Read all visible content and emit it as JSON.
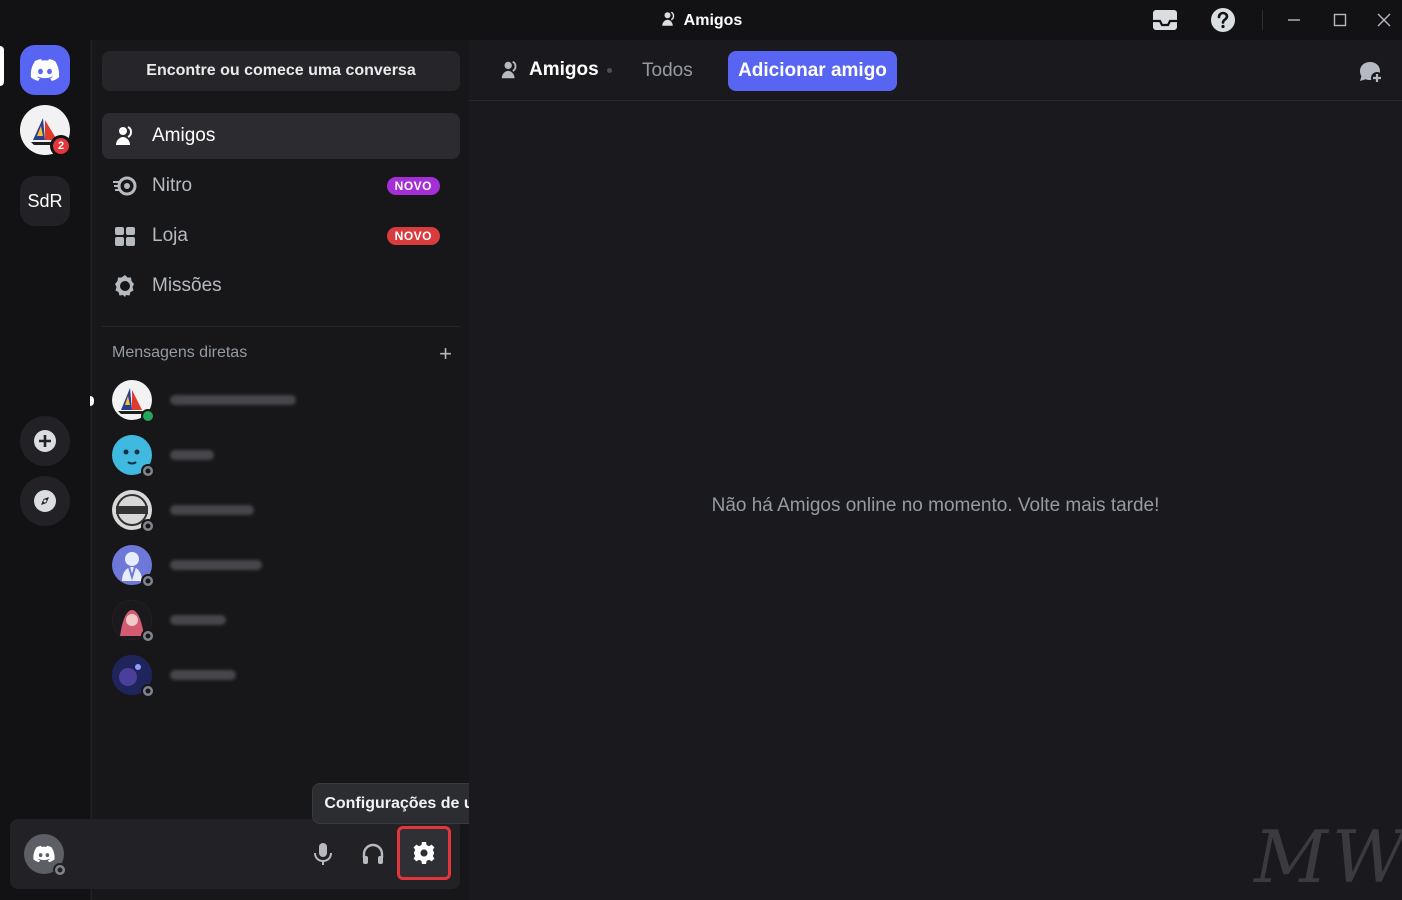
{
  "window": {
    "title": "Amigos"
  },
  "rail": {
    "servers": [
      {
        "name": "server-1",
        "badge": "2"
      },
      {
        "label": "SdR"
      }
    ]
  },
  "sidebar": {
    "search_label": "Encontre ou comece uma conversa",
    "nav": [
      {
        "label": "Amigos"
      },
      {
        "label": "Nitro",
        "badge": "NOVO",
        "badge_color": "#a52fd6"
      },
      {
        "label": "Loja",
        "badge": "NOVO",
        "badge_color": "#d83c3e"
      },
      {
        "label": "Missões"
      }
    ],
    "dm_header": "Mensagens diretas",
    "dm_add": "+",
    "dms": [
      {
        "status": "online"
      },
      {
        "status": "offline"
      },
      {
        "status": "offline"
      },
      {
        "status": "offline"
      },
      {
        "status": "offline"
      },
      {
        "status": "offline"
      }
    ]
  },
  "tooltip": "Configurações de usuário",
  "main": {
    "header_title": "Amigos",
    "tab_all": "Todos",
    "add_friend": "Adicionar amigo",
    "empty_message": "Não há Amigos online no momento. Volte mais tarde!",
    "watermark": "MW"
  },
  "colors": {
    "accent": "#5865f2",
    "online": "#23a55a",
    "highlight": "#e0363c"
  }
}
